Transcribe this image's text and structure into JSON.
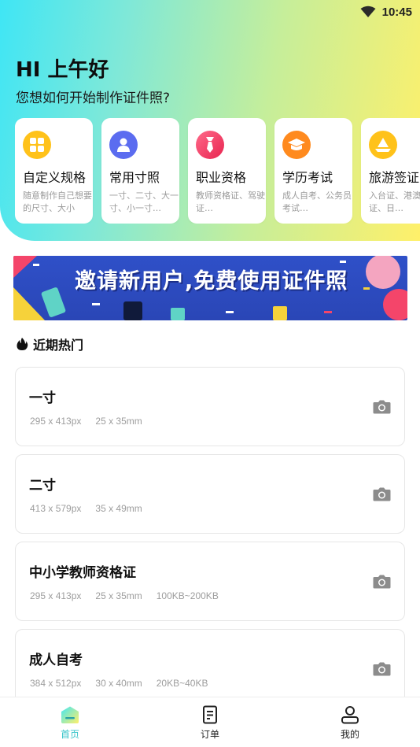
{
  "status_bar": {
    "time": "10:45"
  },
  "header": {
    "greeting": "HI 上午好",
    "subtitle": "您想如何开始制作证件照?"
  },
  "categories": [
    {
      "title": "自定义规格",
      "desc": "随意制作自己想要的尺寸、大小",
      "icon": "grid-icon",
      "color": "#ffc21a"
    },
    {
      "title": "常用寸照",
      "desc": "一寸、二寸、大一寸、小一寸…",
      "icon": "person-icon",
      "color": "#5b6cf0"
    },
    {
      "title": "职业资格",
      "desc": "教师资格证、驾驶证…",
      "icon": "tie-icon",
      "color": "#f4456a"
    },
    {
      "title": "学历考试",
      "desc": "成人自考、公务员考试…",
      "icon": "graduation-cap-icon",
      "color": "#ff8a1e"
    },
    {
      "title": "旅游签证",
      "desc": "入台证、港澳通行证、日…",
      "icon": "sailboat-icon",
      "color": "#ffc21a"
    }
  ],
  "banner": {
    "text": "邀请新用户,免费使用证件照"
  },
  "section": {
    "title": "近期热门",
    "icon": "fire-icon"
  },
  "hot_items": [
    {
      "title": "一寸",
      "meta": [
        "295 x 413px",
        "25 x 35mm"
      ]
    },
    {
      "title": "二寸",
      "meta": [
        "413 x 579px",
        "35 x 49mm"
      ]
    },
    {
      "title": "中小学教师资格证",
      "meta": [
        "295 x 413px",
        "25 x 35mm",
        "100KB~200KB"
      ]
    },
    {
      "title": "成人自考",
      "meta": [
        "384 x 512px",
        "30 x 40mm",
        "20KB~40KB"
      ]
    }
  ],
  "nav": {
    "items": [
      {
        "label": "首页",
        "icon": "home-icon",
        "active": true
      },
      {
        "label": "订单",
        "icon": "order-icon",
        "active": false
      },
      {
        "label": "我的",
        "icon": "profile-icon",
        "active": false
      }
    ],
    "active_color": "#34c3c9"
  }
}
